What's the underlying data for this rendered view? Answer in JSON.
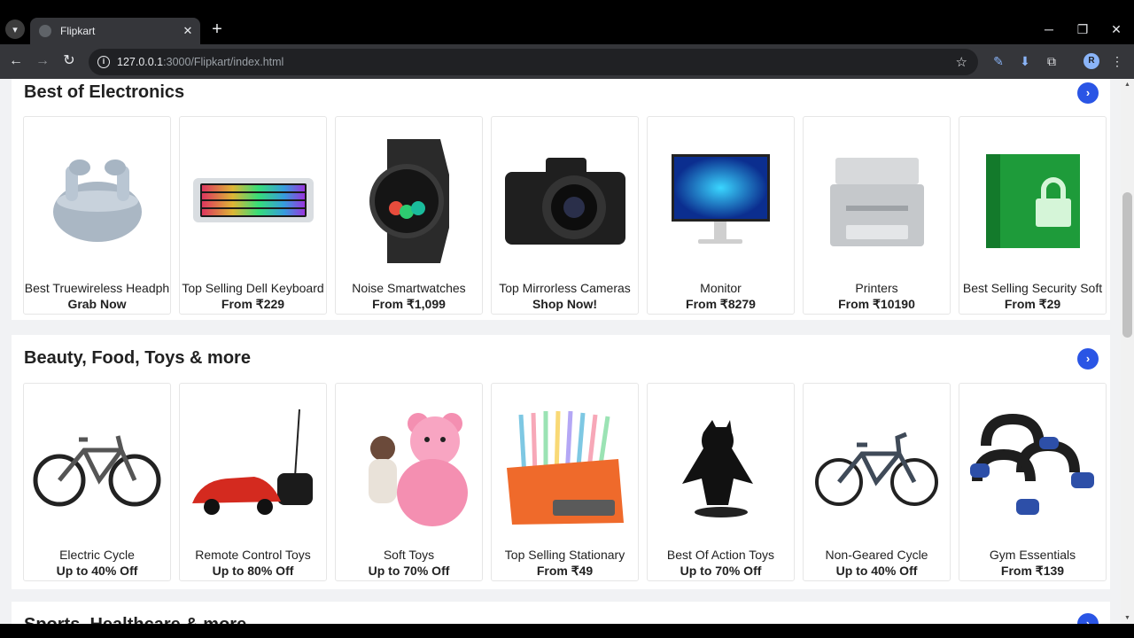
{
  "browser": {
    "tab_title": "Flipkart",
    "url_host": "127.0.0.1",
    "url_path": ":3000/Flipkart/index.html",
    "profile_initial": "R"
  },
  "sections": [
    {
      "title": "Best of Electronics",
      "items": [
        {
          "name": "Best Truewireless Headph",
          "offer": "Grab Now",
          "icon": "earbuds-image"
        },
        {
          "name": "Top Selling Dell Keyboard",
          "offer": "From ₹229",
          "icon": "keyboard-image"
        },
        {
          "name": "Noise Smartwatches",
          "offer": "From ₹1,099",
          "icon": "smartwatch-image"
        },
        {
          "name": "Top Mirrorless Cameras",
          "offer": "Shop Now!",
          "icon": "camera-image"
        },
        {
          "name": "Monitor",
          "offer": "From ₹8279",
          "icon": "monitor-image"
        },
        {
          "name": "Printers",
          "offer": "From ₹10190",
          "icon": "printer-image"
        },
        {
          "name": "Best Selling Security Soft",
          "offer": "From ₹29",
          "icon": "security-software-image"
        }
      ]
    },
    {
      "title": "Beauty, Food, Toys & more",
      "items": [
        {
          "name": "Electric Cycle",
          "offer": "Up to 40% Off",
          "icon": "electric-cycle-image"
        },
        {
          "name": "Remote Control Toys",
          "offer": "Up to 80% Off",
          "icon": "rc-car-image"
        },
        {
          "name": "Soft Toys",
          "offer": "Up to 70% Off",
          "icon": "teddy-bear-image"
        },
        {
          "name": "Top Selling Stationary",
          "offer": "From ₹49",
          "icon": "pens-image"
        },
        {
          "name": "Best Of Action Toys",
          "offer": "Up to 70% Off",
          "icon": "batman-figure-image"
        },
        {
          "name": "Non-Geared Cycle",
          "offer": "Up to 40% Off",
          "icon": "cycle-image"
        },
        {
          "name": "Gym Essentials",
          "offer": "From ₹139",
          "icon": "pushup-bars-image"
        }
      ]
    },
    {
      "title": "Sports, Healthcare & more"
    }
  ]
}
